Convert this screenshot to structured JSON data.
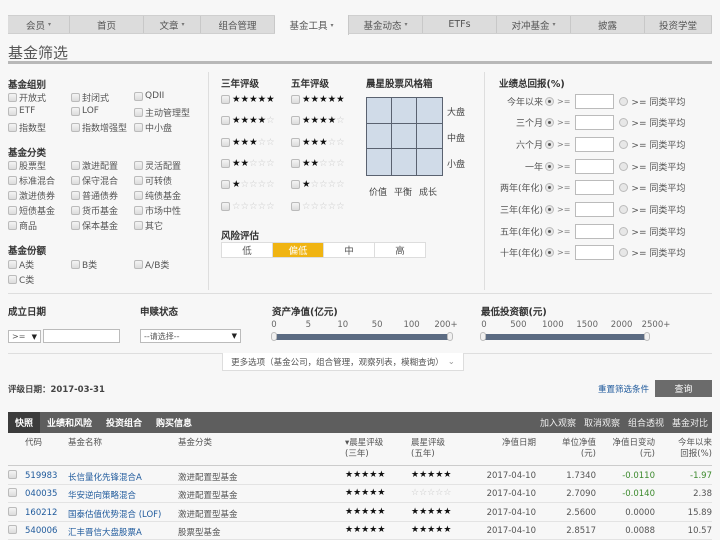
{
  "nav": {
    "items": [
      {
        "label": "会员",
        "dropdown": true
      },
      {
        "label": "首页",
        "dropdown": false
      },
      {
        "label": "文章",
        "dropdown": true
      },
      {
        "label": "组合管理",
        "dropdown": false
      },
      {
        "label": "基金工具",
        "dropdown": true,
        "active": true
      },
      {
        "label": "基金动态",
        "dropdown": true
      },
      {
        "label": "ETFs",
        "dropdown": false
      },
      {
        "label": "对冲基金",
        "dropdown": true
      },
      {
        "label": "披露",
        "dropdown": false
      },
      {
        "label": "投资学堂",
        "dropdown": false
      }
    ],
    "caret": "▾"
  },
  "page_title": "基金筛选",
  "fund_group": {
    "title": "基金组别",
    "items": [
      "开放式",
      "封闭式",
      "QDII",
      "ETF",
      "LOF",
      "主动管理型",
      "指数型",
      "指数增强型",
      "中小盘"
    ]
  },
  "fund_category": {
    "title": "基金分类",
    "items": [
      "股票型",
      "激进配置",
      "灵活配置",
      "标准混合",
      "保守混合",
      "可转债",
      "激进债券",
      "普通债券",
      "纯债基金",
      "短债基金",
      "货币基金",
      "市场中性",
      "商品",
      "保本基金",
      "其它"
    ]
  },
  "fund_share": {
    "title": "基金份额",
    "items": [
      "A类",
      "B类",
      "A/B类",
      "C类"
    ]
  },
  "rating3": {
    "title": "三年评级",
    "levels": [
      5,
      4,
      3,
      2,
      1,
      0
    ]
  },
  "rating5": {
    "title": "五年评级",
    "levels": [
      5,
      4,
      3,
      2,
      1,
      0
    ]
  },
  "style_box": {
    "title": "晨星股票风格箱",
    "rows": [
      "大盘",
      "中盘",
      "小盘"
    ],
    "cols": [
      "价值",
      "平衡",
      "成长"
    ]
  },
  "risk": {
    "title": "风险评估",
    "options": [
      "低",
      "偏低",
      "中",
      "高"
    ],
    "selected": "偏低"
  },
  "returns": {
    "title": "业绩总回报(%)",
    "ge": ">=",
    "avg_label": ">= 同类平均",
    "rows": [
      {
        "label": "今年以来",
        "value": ""
      },
      {
        "label": "三个月",
        "value": ""
      },
      {
        "label": "六个月",
        "value": ""
      },
      {
        "label": "一年",
        "value": ""
      },
      {
        "label": "两年(年化)",
        "value": ""
      },
      {
        "label": "三年(年化)",
        "value": ""
      },
      {
        "label": "五年(年化)",
        "value": ""
      },
      {
        "label": "十年(年化)",
        "value": ""
      }
    ]
  },
  "inception": {
    "title": "成立日期",
    "operator": ">=",
    "value": ""
  },
  "purchase_status": {
    "title": "申赎状态",
    "selected": "--请选择--"
  },
  "net_assets": {
    "title": "资产净值(亿元)",
    "ticks": [
      "0",
      "5",
      "10",
      "50",
      "100",
      "200+"
    ],
    "range_low": "0",
    "range_high": "200+"
  },
  "min_investment": {
    "title": "最低投资额(元)",
    "ticks": [
      "0",
      "500",
      "1000",
      "1500",
      "2000",
      "2500+"
    ],
    "range_low": "0",
    "range_high": "2500+"
  },
  "more_options": "更多选项（基金公司，组合管理，观察列表，模糊查询）",
  "rating_date": "评级日期：2017-03-31",
  "reset_label": "重置筛选条件",
  "query_label": "查询",
  "tabs": [
    "快照",
    "业绩和风险",
    "投资组合",
    "购买信息"
  ],
  "active_tab": "快照",
  "actions": [
    "加入观察",
    "取消观察",
    "组合透视",
    "基金对比"
  ],
  "table": {
    "headers": {
      "code": "代码",
      "name": "基金名称",
      "category": "基金分类",
      "rating3_line1": "▾晨星评级",
      "rating3_line2": "(三年)",
      "rating5_line1": "晨星评级",
      "rating5_line2": "(五年)",
      "nav_date": "净值日期",
      "nav_line1": "单位净值",
      "nav_line2": "(元)",
      "change_line1": "净值日变动",
      "change_line2": "(元)",
      "ytd_line1": "今年以来",
      "ytd_line2": "回报(%)"
    },
    "rows": [
      {
        "code": "519983",
        "name": "长信量化先锋混合A",
        "category": "激进配置型基金",
        "rating3": 5,
        "rating5": 5,
        "nav_date": "2017-04-10",
        "nav": "1.7340",
        "change": "-0.0110",
        "ytd": "-1.97"
      },
      {
        "code": "040035",
        "name": "华安逆向策略混合",
        "category": "激进配置型基金",
        "rating3": 5,
        "rating5": 0,
        "nav_date": "2017-04-10",
        "nav": "2.7090",
        "change": "-0.0140",
        "ytd": "2.38"
      },
      {
        "code": "160212",
        "name": "国泰估值优势混合 (LOF)",
        "category": "激进配置型基金",
        "rating3": 5,
        "rating5": 5,
        "nav_date": "2017-04-10",
        "nav": "2.5600",
        "change": "0.0000",
        "ytd": "15.89"
      },
      {
        "code": "540006",
        "name": "汇丰晋信大盘股票A",
        "category": "股票型基金",
        "rating3": 5,
        "rating5": 5,
        "nav_date": "2017-04-10",
        "nav": "2.8517",
        "change": "0.0088",
        "ytd": "10.57"
      }
    ]
  },
  "colors": {
    "accent_risk": "#f0b412",
    "link": "#1f5a9c",
    "negative": "#3d8a2e",
    "tabbar": "#5e5e5e",
    "slider": "#5b6b82"
  }
}
